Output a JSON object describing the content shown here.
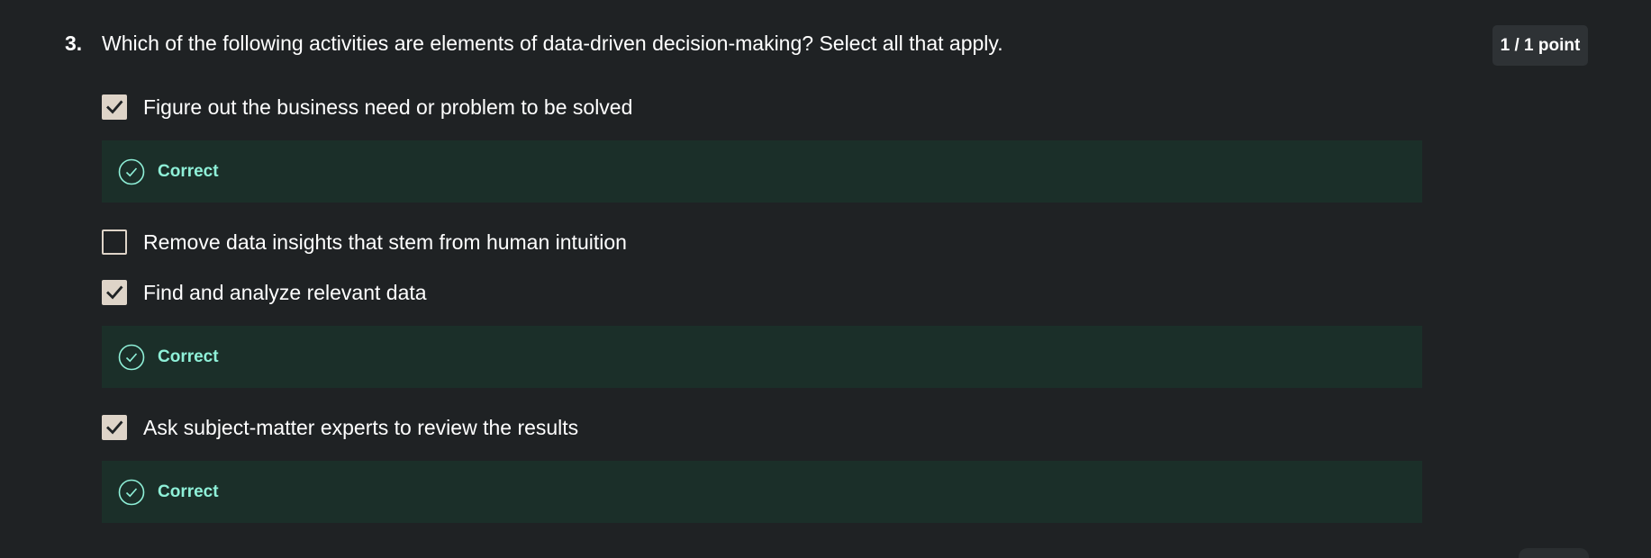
{
  "question": {
    "number": "3.",
    "text": "Which of the following activities are elements of data-driven decision-making? Select all that apply.",
    "points": "1 / 1 point"
  },
  "options": [
    {
      "label": "Figure out the business need or problem to be solved",
      "checked": true,
      "feedback": "Correct"
    },
    {
      "label": "Remove data insights that stem from human intuition",
      "checked": false
    },
    {
      "label": "Find and analyze relevant data",
      "checked": true,
      "feedback": "Correct"
    },
    {
      "label": "Ask subject-matter experts to review the results",
      "checked": true,
      "feedback": "Correct"
    }
  ],
  "colors": {
    "background": "#1f2224",
    "checkbox": "#ded4c8",
    "feedback_background": "#1b2f29",
    "feedback_text": "#8ff0d8",
    "badge_background": "#2e3235"
  },
  "icons": {
    "checked": "checkmark-icon",
    "feedback": "check-circle-icon"
  }
}
